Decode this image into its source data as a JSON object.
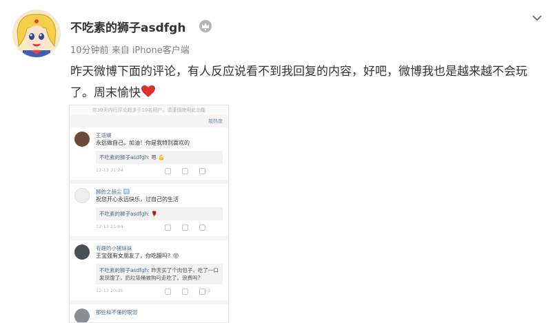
{
  "post": {
    "author": "不吃素的狮子asdfgh",
    "time": "10分钟前",
    "source": "来自 iPhone客户端",
    "text": "昨天微博下面的评论，有人反应说看不到我回复的内容，好吧，微博我也是越来越不会玩了。周末愉快"
  },
  "screenshot": {
    "notice": "你30天内已评论超多于10名用户，请谨慎使用此功能",
    "sort_label": "按热度",
    "comments": [
      {
        "user": "王适斓",
        "text": "永远做自己，加油！你是我特别喜欢的",
        "reply_author": "不吃素的狮子asdfgh:",
        "reply_text": "嗯 💪",
        "time": "12-13 21:24"
      },
      {
        "user": "狮的之赫尘",
        "badge": "粉",
        "text": "祝您开心永远快乐，过自己的生活",
        "reply_author": "不吃素的狮子asdfgh:",
        "reply_text": "🌹",
        "time": "12-13 21:04"
      },
      {
        "user": "有趣的小猪妹妹",
        "text": "王宝强有女朋友了，你吃醋吗？😝",
        "reply_author": "不吃素的狮子asdfgh:",
        "reply_text": "昨天买了个肉包子，吃了一口发现馊了，扔垃圾桶被狗叼走吃了。浪费吗？",
        "time": "12-13 20:35",
        "likes": "3"
      },
      {
        "user": "那些和不懂的眼泪"
      }
    ]
  },
  "colors": {
    "accent_link": "#4f6f94",
    "heart": "#e0302b",
    "meta": "#808080"
  },
  "icons": [
    "avatar-anime-girl",
    "vip-crown-icon",
    "chevron-down-icon",
    "red-heart-icon"
  ]
}
